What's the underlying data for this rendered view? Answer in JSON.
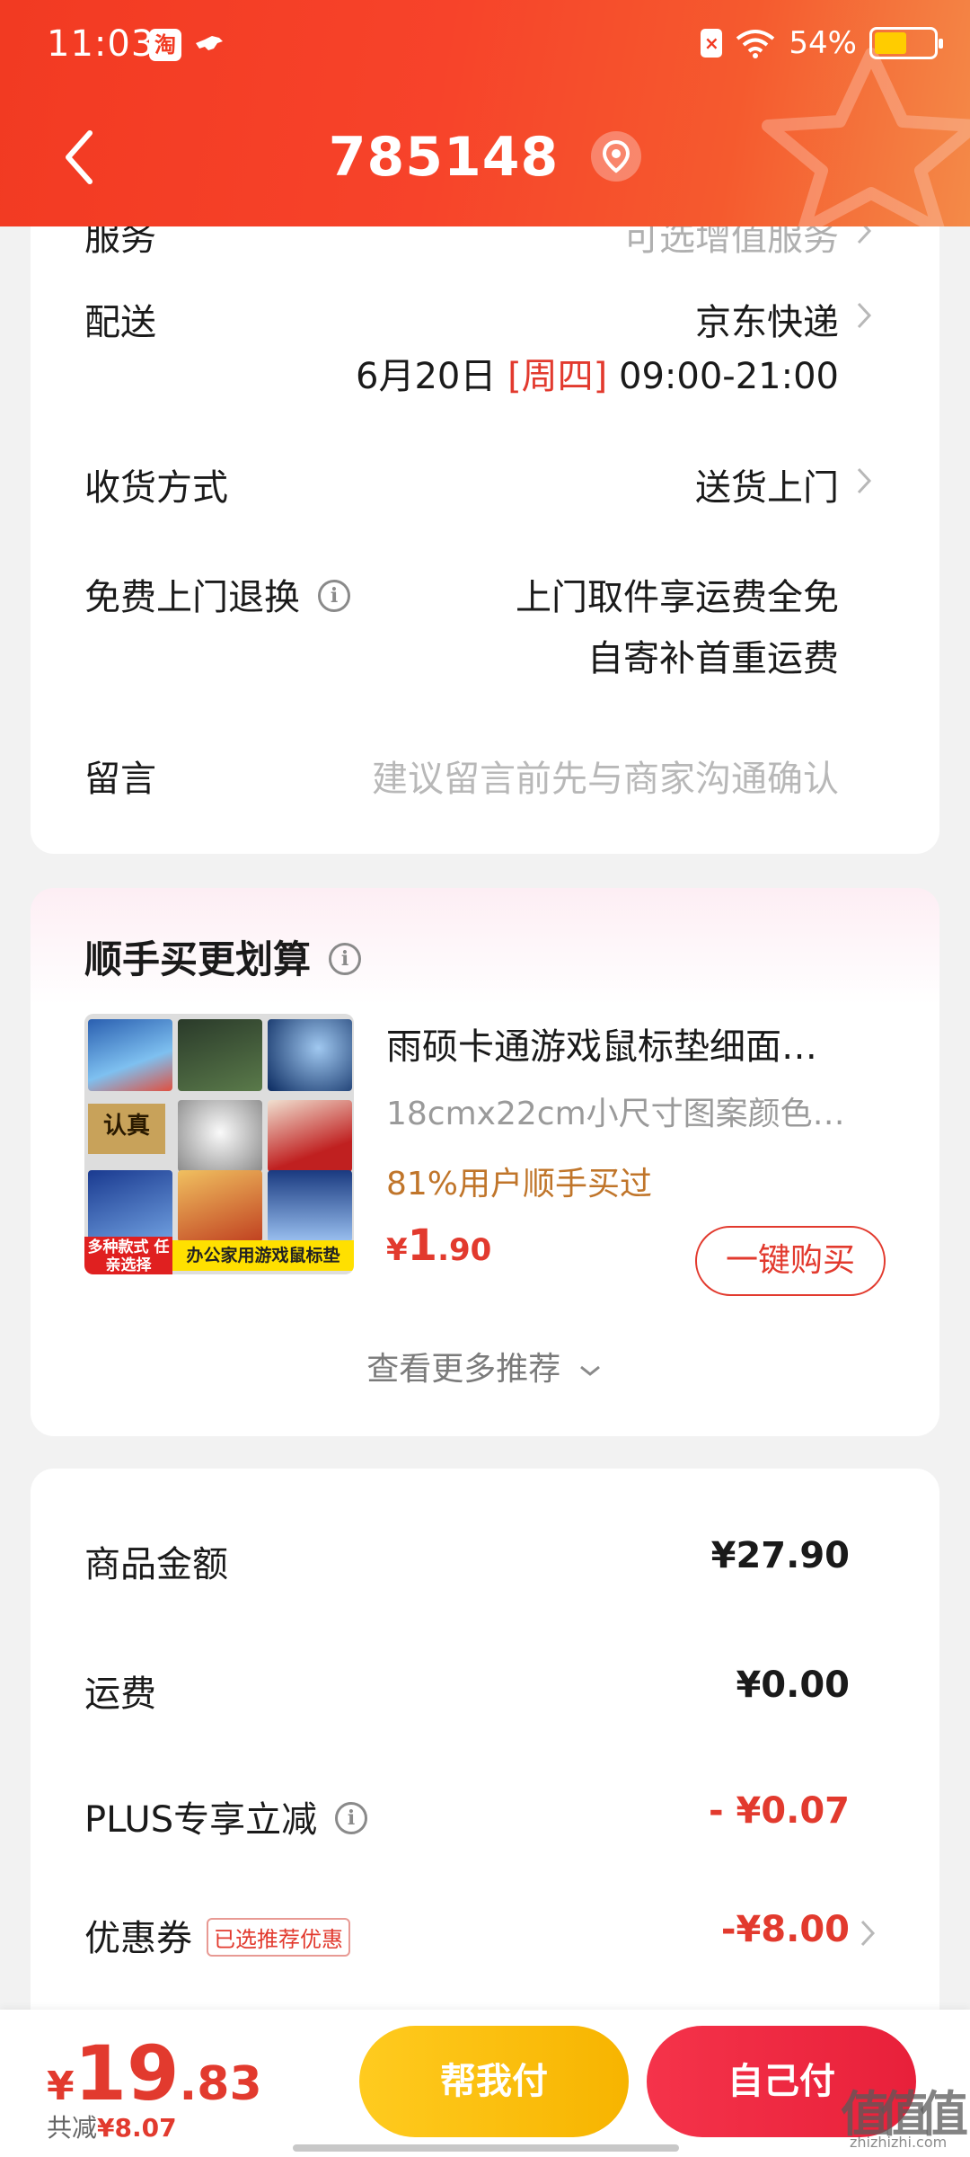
{
  "status_bar": {
    "time": "11:03",
    "app1": "淘",
    "battery_pct": "54%",
    "battery_level": 0.54
  },
  "header": {
    "title": "785148"
  },
  "order_info": {
    "service": {
      "label": "服务",
      "value": "可选增值服务"
    },
    "delivery": {
      "label": "配送",
      "carrier": "京东快递",
      "date": "6月20日",
      "weekday": "[周四]",
      "time": "09:00-21:00"
    },
    "receive": {
      "label": "收货方式",
      "value": "送货上门"
    },
    "free_return": {
      "label": "免费上门退换",
      "line1": "上门取件享运费全免",
      "line2": "自寄补首重运费"
    },
    "message": {
      "label": "留言",
      "placeholder": "建议留言前先与商家沟通确认"
    }
  },
  "recommend": {
    "title": "顺手买更划算",
    "image_tags": {
      "tag_top": "认真",
      "tag_left": "多种款式 任亲选择",
      "tag_right": "办公家用游戏鼠标垫"
    },
    "product": {
      "name": "雨硕卡通游戏鼠标垫细面…",
      "spec": "18cmx22cm小尺寸图案颜色…",
      "hint": "81%用户顺手买过",
      "price_currency": "¥",
      "price_int": "1",
      "price_dec": ".90",
      "buy_label": "一键购买"
    },
    "more_label": "查看更多推荐"
  },
  "summary": {
    "goods": {
      "label": "商品金额",
      "value": "¥27.90"
    },
    "shipping": {
      "label": "运费",
      "value": "¥0.00"
    },
    "plus": {
      "label": "PLUS专享立减",
      "value": "- ¥0.07"
    },
    "coupon": {
      "label": "优惠券",
      "tag": "已选推荐优惠",
      "value": "-¥8.00"
    }
  },
  "bottom": {
    "total_currency": "¥",
    "total_int": "19",
    "total_dec": ".83",
    "saved_label": "共减",
    "saved_value": "¥8.07",
    "help_pay": "帮我付",
    "self_pay": "自己付"
  },
  "watermark": {
    "glyphs": "值",
    "url": "zhizhizhi.com"
  },
  "colors": {
    "accent_red": "#e23a2e",
    "header_red": "#f23a22",
    "yellow_button": "#ffcb1f",
    "hint_orange": "#c0752a"
  }
}
